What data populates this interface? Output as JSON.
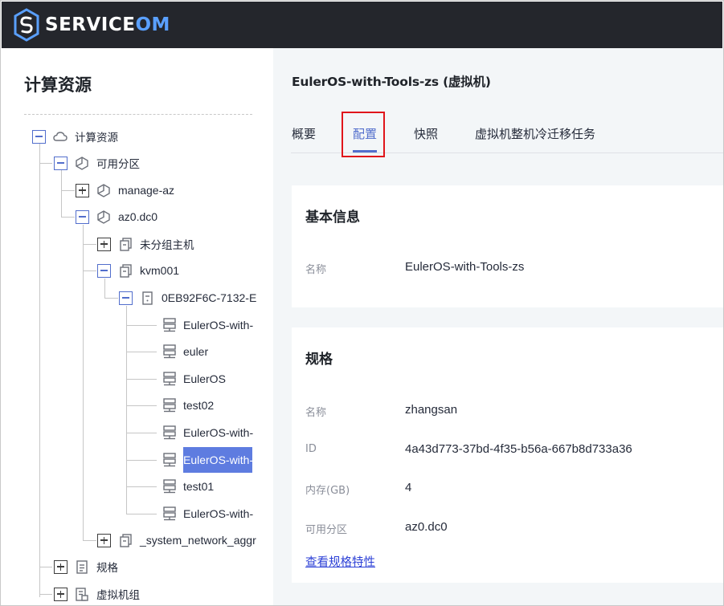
{
  "brand": {
    "logo_prefix": "SERVICE",
    "logo_suffix": "OM"
  },
  "sidebar": {
    "title": "计算资源",
    "tree": [
      {
        "label": "计算资源",
        "state": "expanded",
        "icon": "cloud-icon"
      },
      {
        "label": "可用分区",
        "state": "expanded",
        "icon": "zone-icon"
      },
      {
        "label": "manage-az",
        "state": "collapsed",
        "icon": "zone-icon"
      },
      {
        "label": "az0.dc0",
        "state": "expanded",
        "icon": "zone-icon"
      },
      {
        "label": "未分组主机",
        "state": "collapsed",
        "icon": "host-group-icon"
      },
      {
        "label": "kvm001",
        "state": "expanded",
        "icon": "host-group-icon"
      },
      {
        "label": "0EB92F6C-7132-E",
        "state": "expanded",
        "icon": "host-icon"
      },
      {
        "label": "EulerOS-with-",
        "icon": "vm-icon"
      },
      {
        "label": "euler",
        "icon": "vm-icon"
      },
      {
        "label": "EulerOS",
        "icon": "vm-icon"
      },
      {
        "label": "test02",
        "icon": "vm-icon"
      },
      {
        "label": "EulerOS-with-",
        "icon": "vm-icon"
      },
      {
        "label": "EulerOS-with-",
        "icon": "vm-icon",
        "selected": true
      },
      {
        "label": "test01",
        "icon": "vm-icon"
      },
      {
        "label": "EulerOS-with-",
        "icon": "vm-icon"
      },
      {
        "label": "_system_network_aggr",
        "state": "collapsed",
        "icon": "host-group-icon"
      },
      {
        "label": "规格",
        "state": "collapsed",
        "icon": "document-icon"
      },
      {
        "label": "虚拟机组",
        "state": "collapsed",
        "icon": "vm-group-icon"
      }
    ]
  },
  "main": {
    "title": "EulerOS-with-Tools-zs (虚拟机)",
    "tabs": [
      {
        "label": "概要",
        "active": false
      },
      {
        "label": "配置",
        "active": true
      },
      {
        "label": "快照",
        "active": false
      },
      {
        "label": "虚拟机整机冷迁移任务",
        "active": false
      }
    ],
    "basic_info": {
      "title": "基本信息",
      "rows": [
        {
          "label": "名称",
          "value": "EulerOS-with-Tools-zs"
        }
      ]
    },
    "spec": {
      "title": "规格",
      "rows": [
        {
          "label": "名称",
          "value": "zhangsan"
        },
        {
          "label": "ID",
          "value": "4a43d773-37bd-4f35-b56a-667b8d733a36"
        },
        {
          "label": "内存(GB)",
          "value": "4"
        },
        {
          "label": "可用分区",
          "value": "az0.dc0"
        }
      ],
      "link": "查看规格特性"
    }
  },
  "colors": {
    "accent": "#526ecc",
    "selected_bg": "#5e7ce0",
    "highlight": "#e0151b",
    "topbar": "#24262c"
  }
}
